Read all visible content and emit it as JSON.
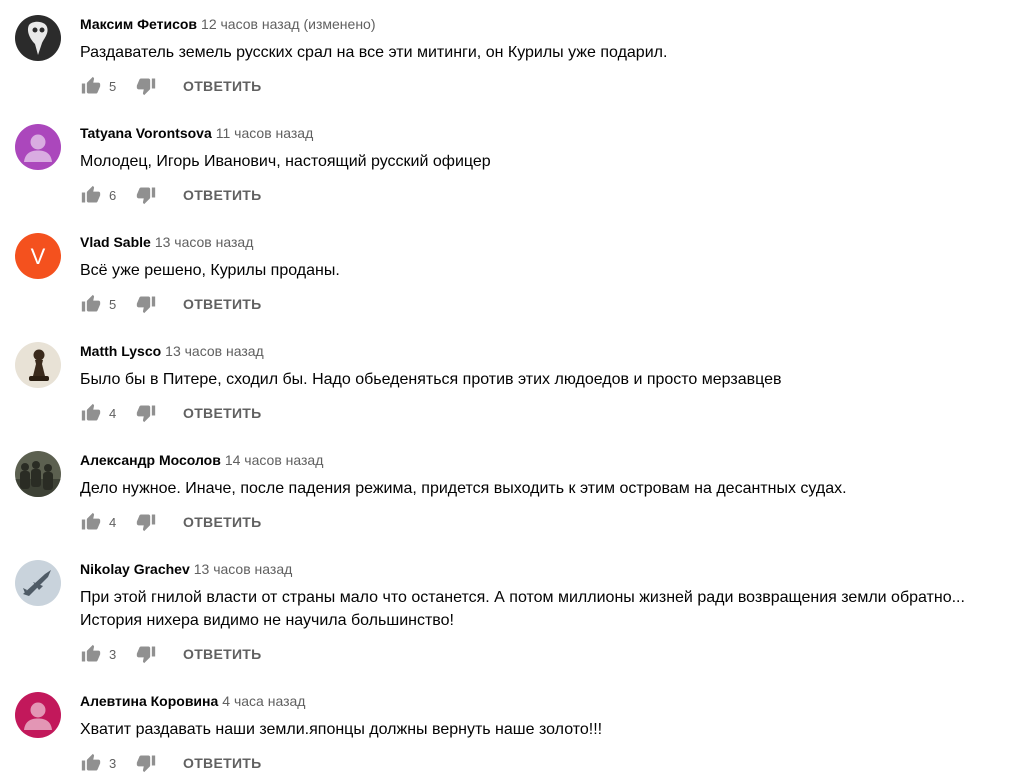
{
  "ui": {
    "reply_label": "ОТВЕТИТЬ"
  },
  "comments": [
    {
      "author": "Максим Фетисов",
      "time": "12 часов назад (изменено)",
      "text_lines": [
        "Раздаватель земель русских срал на все эти митинги, он Курилы уже подарил."
      ],
      "likes": "5",
      "avatar": {
        "type": "image",
        "icon": "plague-mask-avatar",
        "bg": "#2b2b2b"
      }
    },
    {
      "author": "Tatyana Vorontsova",
      "time": "11 часов назад",
      "text_lines": [
        "Молодец, Игорь Иванович, настоящий русский офицер"
      ],
      "likes": "6",
      "avatar": {
        "type": "default-person",
        "icon": "person-icon",
        "bg": "#ab47bc"
      }
    },
    {
      "author": "Vlad Sable",
      "time": "13 часов назад",
      "text_lines": [
        "Всё уже решено, Курилы проданы."
      ],
      "likes": "5",
      "avatar": {
        "type": "letter",
        "letter": "V",
        "icon": "letter-avatar",
        "bg": "#f4511e"
      }
    },
    {
      "author": "Matth Lysco",
      "time": "13 часов назад",
      "text_lines": [
        "Было бы в Питере, сходил бы. Надо обьеденяться против этих людоедов и просто мерзавцев"
      ],
      "likes": "4",
      "avatar": {
        "type": "image",
        "icon": "chess-pawn-avatar",
        "bg": "#e8e2d6"
      }
    },
    {
      "author": "Александр Мосолов",
      "time": "14 часов назад",
      "text_lines": [
        "Дело нужное. Иначе, после падения режима, придется выходить к этим островам на десантных судах."
      ],
      "likes": "4",
      "avatar": {
        "type": "image",
        "icon": "soldiers-avatar",
        "bg": "#5c6050"
      }
    },
    {
      "author": "Nikolay Grachev",
      "time": "13 часов назад",
      "text_lines": [
        "При этой гнилой власти от страны мало что останется. А потом миллионы жизней ради возвращения земли обратно...",
        "История нихера видимо не научила большинство!"
      ],
      "likes": "3",
      "avatar": {
        "type": "image",
        "icon": "fighter-jet-avatar",
        "bg": "#c9d3dc"
      }
    },
    {
      "author": "Алевтина Коровина",
      "time": "4 часа назад",
      "text_lines": [
        "Хватит раздавать наши земли.японцы должны вернуть наше золото!!!"
      ],
      "likes": "3",
      "avatar": {
        "type": "default-person",
        "icon": "person-icon",
        "bg": "#c2185b"
      }
    }
  ]
}
